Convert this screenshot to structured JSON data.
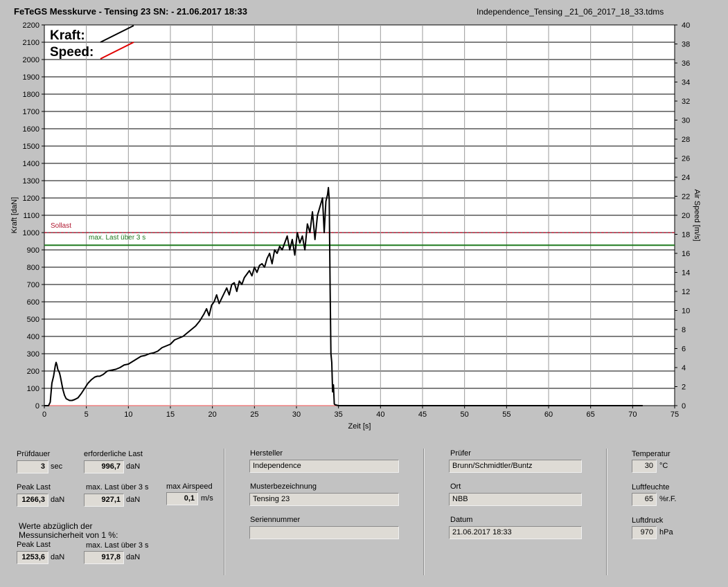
{
  "header": {
    "title": "FeTeGS Messkurve - Tensing 23  SN:  - 21.06.2017 18:33",
    "filename": "Independence_Tensing _21_06_2017_18_33.tdms"
  },
  "chart_data": {
    "type": "line",
    "xlabel": "Zeit [s]",
    "ylabel": "Kraft [daN]",
    "y2label": "Air Speed [m/s]",
    "xlim": [
      0,
      75
    ],
    "ylim": [
      0,
      2200
    ],
    "y2lim": [
      0,
      40
    ],
    "xticks": [
      0,
      5,
      10,
      15,
      20,
      25,
      30,
      35,
      40,
      45,
      50,
      55,
      60,
      65,
      70,
      75
    ],
    "yticks": [
      0,
      100,
      200,
      300,
      400,
      500,
      600,
      700,
      800,
      900,
      1000,
      1100,
      1200,
      1300,
      1400,
      1500,
      1600,
      1700,
      1800,
      1900,
      2000,
      2100,
      2200
    ],
    "y2ticks": [
      0,
      2,
      4,
      6,
      8,
      10,
      12,
      14,
      16,
      18,
      20,
      22,
      24,
      26,
      28,
      30,
      32,
      34,
      36,
      38,
      40
    ],
    "legend": {
      "placement": "top-left",
      "entries": [
        {
          "name": "Kraft:",
          "color": "#000000"
        },
        {
          "name": "Speed:",
          "color": "#e00000"
        }
      ]
    },
    "reference_lines": [
      {
        "label": "Sollast",
        "value": 1000,
        "color": "#b01830"
      },
      {
        "label": "max. Last über  3 s",
        "value": 927.1,
        "color": "#1e7a1e"
      }
    ],
    "series": [
      {
        "name": "Kraft:",
        "color": "#000000",
        "x": [
          0,
          0.5,
          0.7,
          0.9,
          1.0,
          1.1,
          1.2,
          1.3,
          1.4,
          1.5,
          1.6,
          1.7,
          1.8,
          1.9,
          2.0,
          2.2,
          2.4,
          2.6,
          2.8,
          3.0,
          3.3,
          3.6,
          4.0,
          4.4,
          4.8,
          5.2,
          5.6,
          6.0,
          6.3,
          6.6,
          7.0,
          7.5,
          8.0,
          8.5,
          9.0,
          9.5,
          10.0,
          10.5,
          11.0,
          11.5,
          12.0,
          12.5,
          13.0,
          13.5,
          14.0,
          14.5,
          15.0,
          15.5,
          16.0,
          16.5,
          17.0,
          17.5,
          18.0,
          18.5,
          19.0,
          19.3,
          19.6,
          19.9,
          20.2,
          20.5,
          20.8,
          21.1,
          21.4,
          21.7,
          22.0,
          22.3,
          22.6,
          22.9,
          23.2,
          23.5,
          23.8,
          24.1,
          24.4,
          24.7,
          25.0,
          25.3,
          25.6,
          25.9,
          26.2,
          26.5,
          26.8,
          27.1,
          27.4,
          27.7,
          28.0,
          28.3,
          28.6,
          28.9,
          29.2,
          29.5,
          29.8,
          30.1,
          30.4,
          30.7,
          31.0,
          31.3,
          31.6,
          31.9,
          32.2,
          32.5,
          32.8,
          33.1,
          33.3,
          33.5,
          33.7,
          33.8,
          33.9,
          34.0,
          34.1,
          34.2,
          34.3,
          34.4,
          34.5,
          34.6,
          35.0,
          40,
          50,
          60,
          71.2
        ],
        "y": [
          0,
          0,
          20,
          130,
          150,
          170,
          200,
          230,
          250,
          235,
          210,
          200,
          190,
          170,
          145,
          95,
          60,
          40,
          35,
          30,
          30,
          35,
          45,
          70,
          100,
          130,
          150,
          165,
          170,
          170,
          180,
          200,
          205,
          210,
          220,
          235,
          240,
          255,
          270,
          285,
          290,
          300,
          305,
          315,
          335,
          345,
          355,
          380,
          390,
          400,
          420,
          440,
          460,
          490,
          530,
          560,
          520,
          580,
          600,
          640,
          590,
          620,
          650,
          680,
          640,
          700,
          710,
          660,
          720,
          700,
          740,
          760,
          780,
          750,
          800,
          770,
          810,
          820,
          800,
          850,
          880,
          820,
          900,
          880,
          920,
          900,
          940,
          980,
          900,
          960,
          870,
          1000,
          940,
          980,
          900,
          1050,
          1000,
          1120,
          960,
          1100,
          1150,
          1200,
          1000,
          1180,
          1220,
          1260,
          1190,
          700,
          300,
          250,
          80,
          120,
          10,
          5,
          0,
          0,
          0,
          0,
          0
        ]
      },
      {
        "name": "Speed:",
        "color": "#e00000",
        "x": [
          0,
          71.2
        ],
        "y": [
          0,
          0
        ]
      }
    ]
  },
  "panel": {
    "pruefdauer": {
      "label": "Prüfdauer",
      "value": "3",
      "unit": "sec"
    },
    "erforderliche_last": {
      "label": "erforderliche Last",
      "value": "996,7",
      "unit": "daN"
    },
    "peak_last": {
      "label": "Peak Last",
      "value": "1266,3",
      "unit": "daN"
    },
    "max_last_3s": {
      "label": "max. Last über  3 s",
      "value": "927,1",
      "unit": "daN"
    },
    "max_airspeed": {
      "label": "max Airspeed",
      "value": "0,1",
      "unit": "m/s"
    },
    "werte_note_line1": "Werte abzüglich der",
    "werte_note_line2": "Messunsicherheit von 1  %:",
    "peak_last_adj": {
      "label": "Peak Last",
      "value": "1253,6",
      "unit": "daN"
    },
    "max_last_3s_adj": {
      "label": "max. Last über  3 s",
      "value": "917,8",
      "unit": "daN"
    },
    "hersteller": {
      "label": "Hersteller",
      "value": "Independence"
    },
    "musterbezeichnung": {
      "label": "Musterbezeichnung",
      "value": "Tensing 23"
    },
    "seriennummer": {
      "label": "Seriennummer",
      "value": ""
    },
    "pruefer": {
      "label": "Prüfer",
      "value": "Brunn/Schmidtler/Buntz"
    },
    "ort": {
      "label": "Ort",
      "value": "NBB"
    },
    "datum": {
      "label": "Datum",
      "value": "21.06.2017 18:33"
    },
    "temperatur": {
      "label": "Temperatur",
      "value": "30",
      "unit": "°C"
    },
    "luftfeuchte": {
      "label": "Luftfeuchte",
      "value": "65",
      "unit": "%r.F."
    },
    "luftdruck": {
      "label": "Luftdruck",
      "value": "970",
      "unit": "hPa"
    }
  }
}
